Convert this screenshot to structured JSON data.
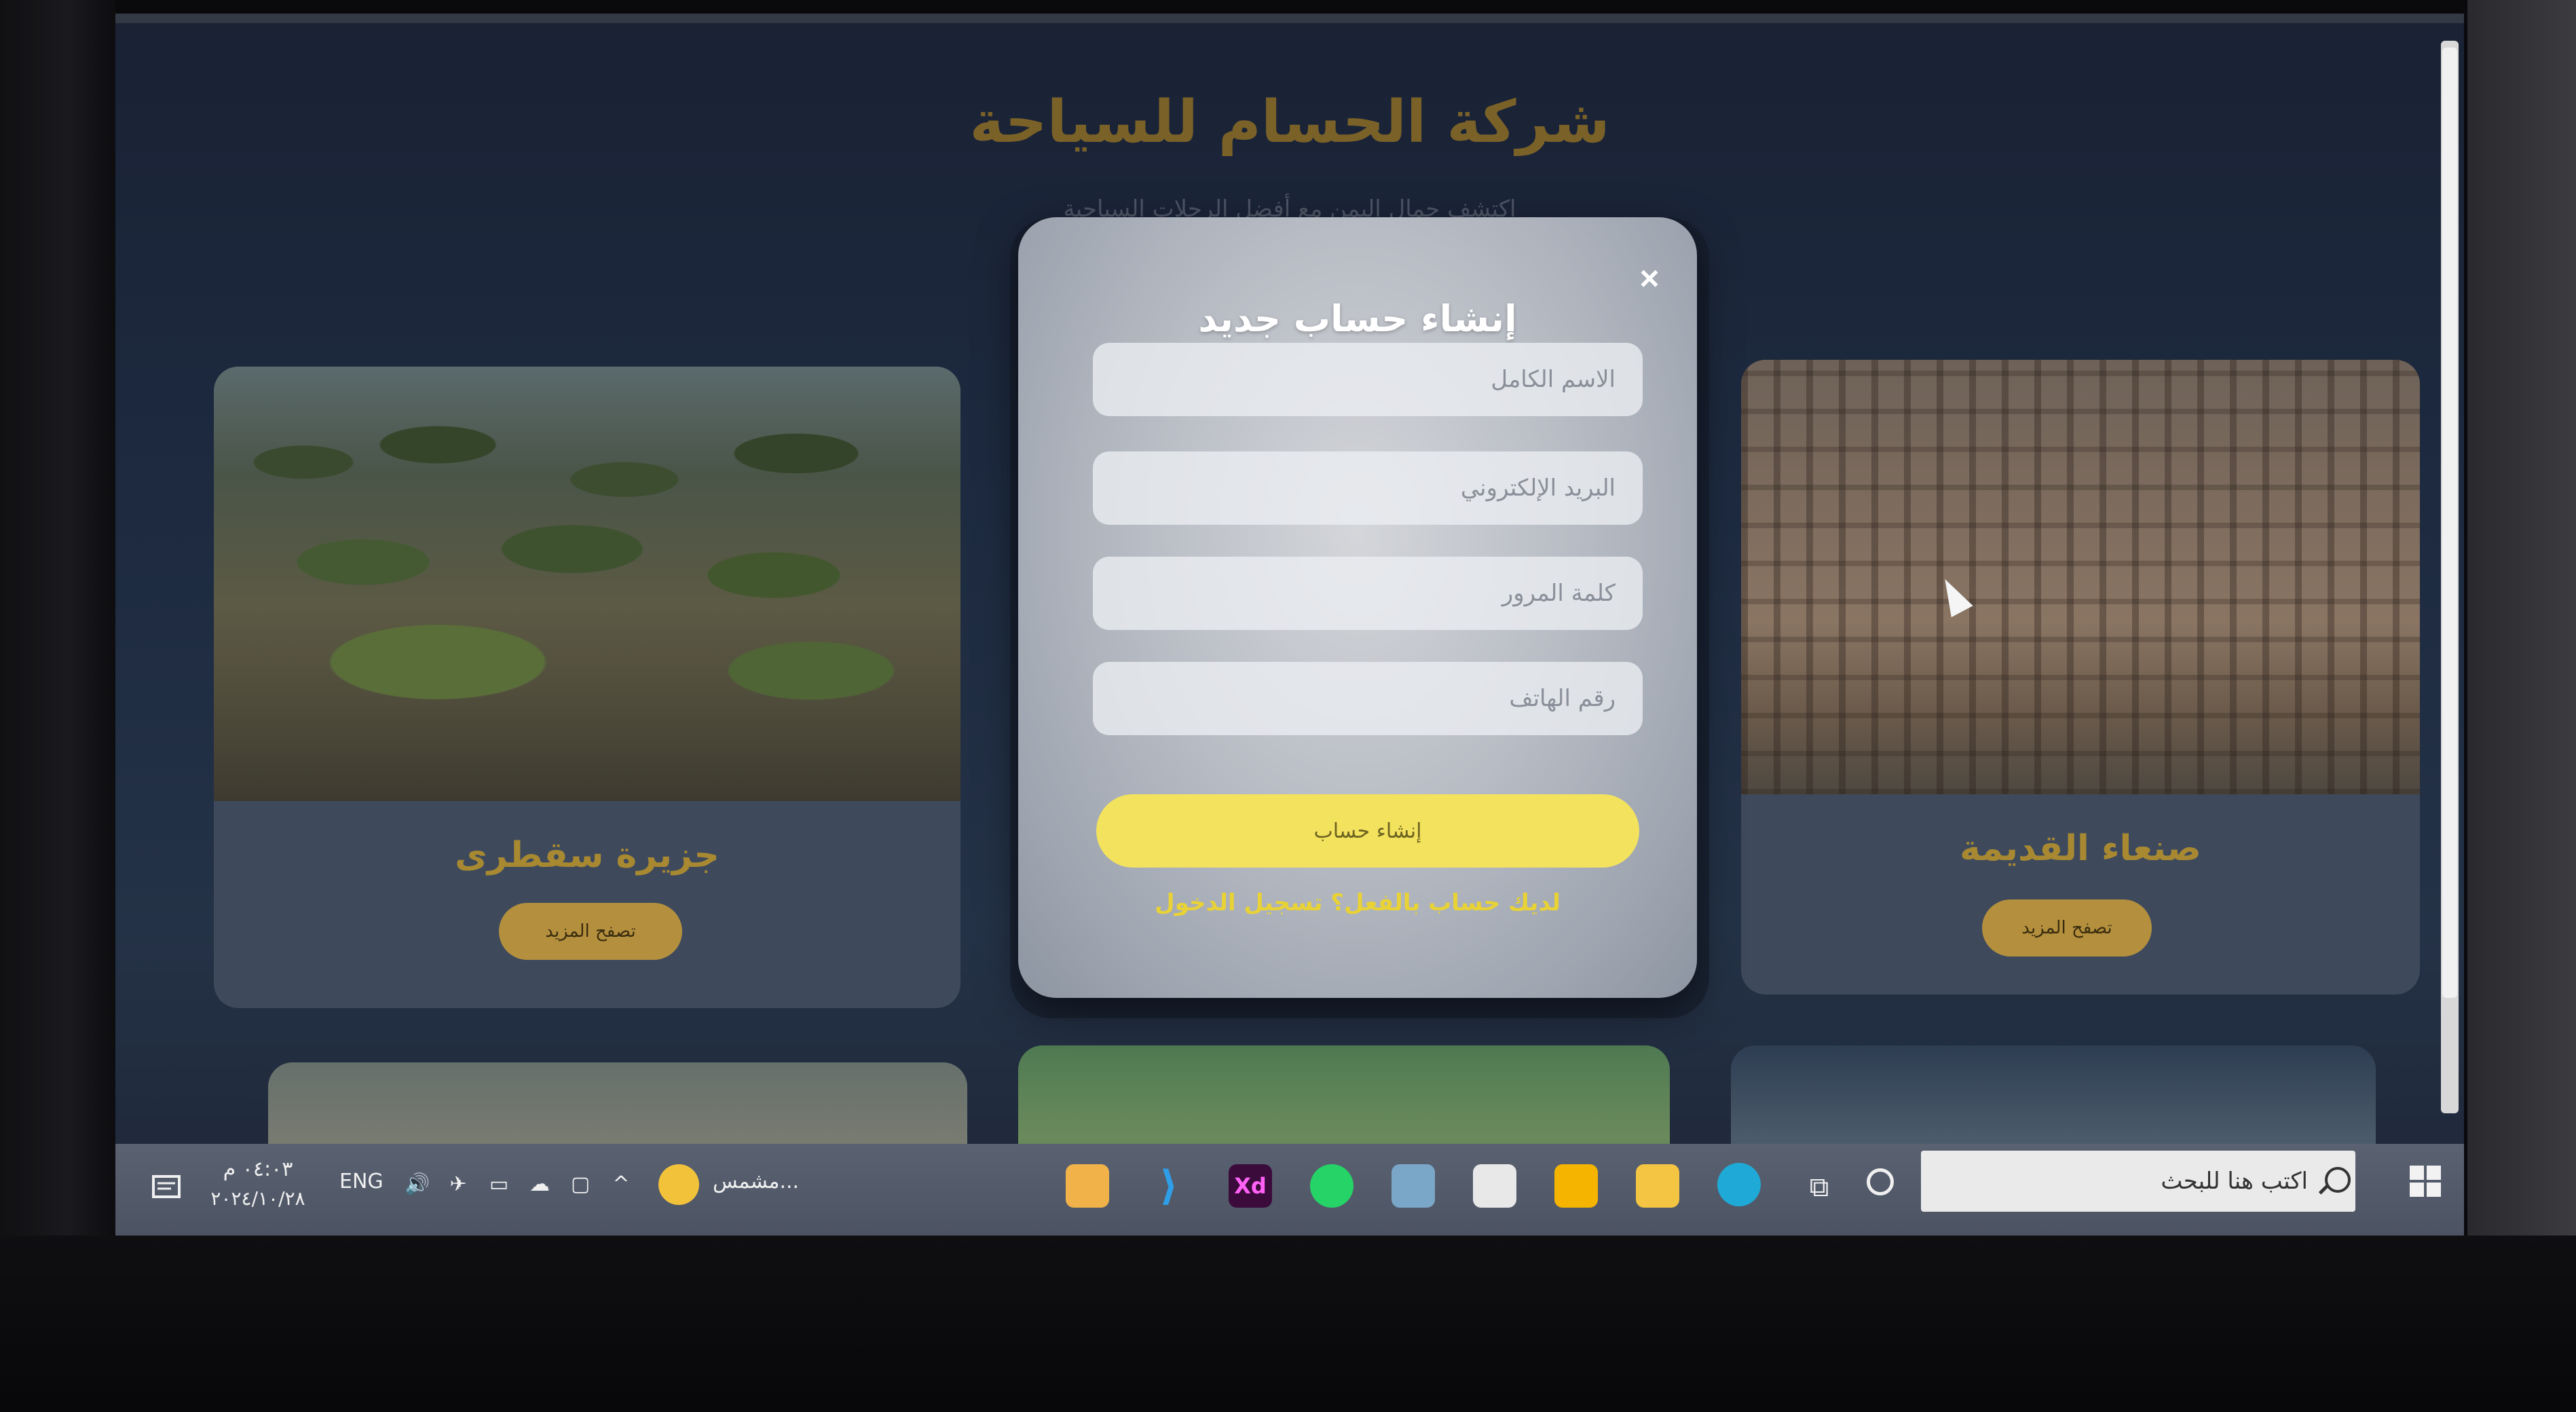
{
  "page": {
    "title": "شركة الحسام للسياحة",
    "subtitle": "اكتشف جمال اليمن مع أفضل الرحلات السياحية"
  },
  "cards": [
    {
      "title": "جزيرة سقطرى",
      "button": "تصفح المزيد"
    },
    {
      "title": "صنعاء القديمة",
      "button": "تصفح المزيد"
    }
  ],
  "modal": {
    "close": "×",
    "title": "إنشاء حساب جديد",
    "fields": {
      "full_name_placeholder": "الاسم الكامل",
      "email_placeholder": "البريد الإلكتروني",
      "password_placeholder": "كلمة المرور",
      "phone_placeholder": "رقم الهاتف"
    },
    "submit": "إنشاء حساب",
    "login_link": "لديك حساب بالفعل؟ تسجيل الدخول"
  },
  "taskbar": {
    "search_placeholder": "اكتب هنا للبحث",
    "language": "ENG",
    "time": "٠٤:٠٣ م",
    "date": "٢٠٢٤/١٠/٢٨",
    "weather": "مشمس...",
    "apps": [
      "photos",
      "vscode",
      "Xd",
      "whatsapp",
      "snipping-tool",
      "mail",
      "store",
      "file-explorer",
      "edge"
    ]
  },
  "colors": {
    "accent_gold": "#b4903e",
    "submit_yellow": "#f3e25e",
    "link_yellow": "#e8d236"
  }
}
